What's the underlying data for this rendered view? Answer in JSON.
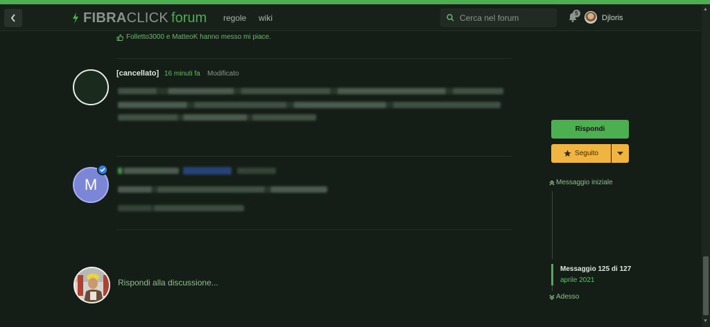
{
  "header": {
    "logo_fibra": "FIBRA",
    "logo_click": "CLICK",
    "logo_forum": "forum",
    "nav": [
      "regole",
      "wiki"
    ],
    "search_placeholder": "Cerca nel forum",
    "notification_count": "5",
    "username": "Djloris"
  },
  "posts": {
    "likes_text": "Folletto3000 e MatteoK hanno messo mi piace.",
    "deleted_post": {
      "author": "[cancellato]",
      "time": "16 minuti fa",
      "edited": "Modificato"
    },
    "second_post": {
      "avatar_letter": "M"
    }
  },
  "reply": {
    "placeholder": "Rispondi alla discussione..."
  },
  "sidebar": {
    "reply_button": "Rispondi",
    "follow_button": "Seguito",
    "first_message": "Messaggio iniziale",
    "position": "Messaggio 125 di 127",
    "date": "aprile 2021",
    "now": "Adesso"
  },
  "colors": {
    "accent": "#4caf50",
    "follow": "#f0b441",
    "background": "#151e16"
  }
}
